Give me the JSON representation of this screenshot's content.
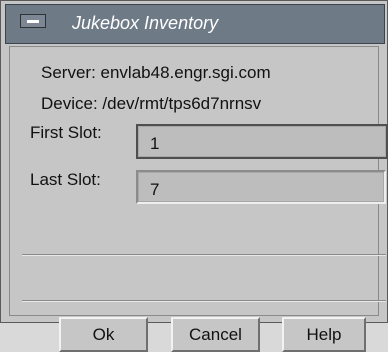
{
  "window": {
    "title": "Jukebox Inventory"
  },
  "info": {
    "server_text": "Server:  envlab48.engr.sgi.com",
    "device_text": "Device:  /dev/rmt/tps6d7nrnsv"
  },
  "fields": {
    "first_slot": {
      "label": "First Slot:",
      "value": "1"
    },
    "last_slot": {
      "label": "Last Slot:",
      "value": "7"
    }
  },
  "buttons": {
    "ok": "Ok",
    "cancel": "Cancel",
    "help": "Help"
  },
  "colors": {
    "titlebar": "#6f7a87",
    "background": "#c6c6c6"
  },
  "icons": {
    "window_menu": "window-menu-icon"
  }
}
